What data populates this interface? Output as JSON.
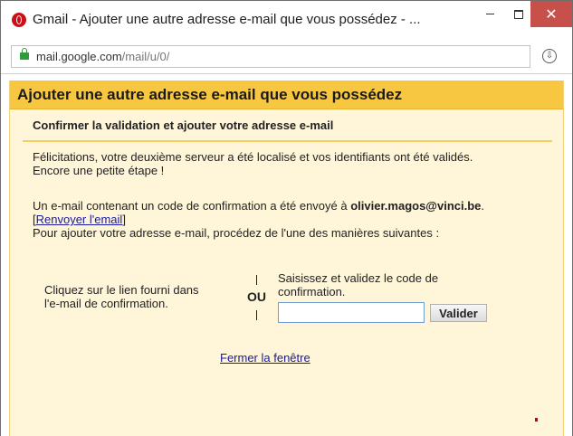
{
  "window": {
    "title": "Gmail - Ajouter une autre adresse e-mail que vous possédez - ...",
    "minimize_glyph": "",
    "maximize_glyph": "",
    "close_glyph": "✕"
  },
  "address_bar": {
    "url_host": "mail.google.com",
    "url_path": "/mail/u/0/"
  },
  "dialog": {
    "title": "Ajouter une autre adresse e-mail que vous possédez",
    "section_title": "Confirmer la validation et ajouter votre adresse e-mail",
    "congrats_line1": "Félicitations, votre deuxième serveur a été localisé et vos identifiants ont été validés.",
    "congrats_line2": "Encore une petite étape !",
    "sent_prefix": "Un e-mail contenant un code de confirmation a été envoyé à ",
    "sent_email": "olivier.magos@vinci.be",
    "sent_suffix": ".",
    "resend_open": "[",
    "resend_link": "Renvoyer l'email",
    "resend_close": "]",
    "instructions": "Pour ajouter votre adresse e-mail, procédez de l'une des manières suivantes :",
    "option1_line1": "Cliquez sur le lien fourni dans",
    "option1_line2": "l'e-mail de confirmation.",
    "or_label": "OU",
    "option2_line1": "Saisissez et validez le code de",
    "option2_line2": "confirmation.",
    "code_value": "",
    "validate_label": "Valider",
    "close_window_link": "Fermer la fenêtre"
  },
  "colors": {
    "header_bg": "#f8c741",
    "content_bg": "#fff5d9",
    "close_button_bg": "#c7504b",
    "link": "#1a1a9c",
    "lock_green": "#2f9b3a"
  }
}
